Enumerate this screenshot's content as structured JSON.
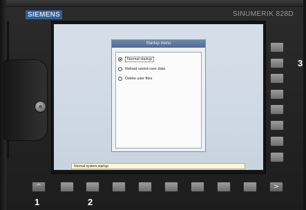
{
  "brand": "SIEMENS",
  "model": "SINUMERIK 828D",
  "dialog": {
    "title": "Startup menu",
    "options": [
      {
        "label": "Normal startup",
        "checked": true
      },
      {
        "label": "Reload saved user data",
        "checked": false
      },
      {
        "label": "Delete user files",
        "checked": false
      }
    ]
  },
  "status_text": "Normal system startup",
  "callouts": [
    "1",
    "2",
    "3"
  ],
  "icons": {
    "rotary": "rotary-knob-icon",
    "recall": "up-caret-icon",
    "etc": "right-caret-icon"
  },
  "glyphs": {
    "recall": "^",
    "etc": ">"
  },
  "colors": {
    "brand_bg": "#2f5f9a",
    "title_bar": "#4f6a91",
    "status_bg": "#fbf7d6",
    "screen_bg": "#cfd9e5"
  }
}
